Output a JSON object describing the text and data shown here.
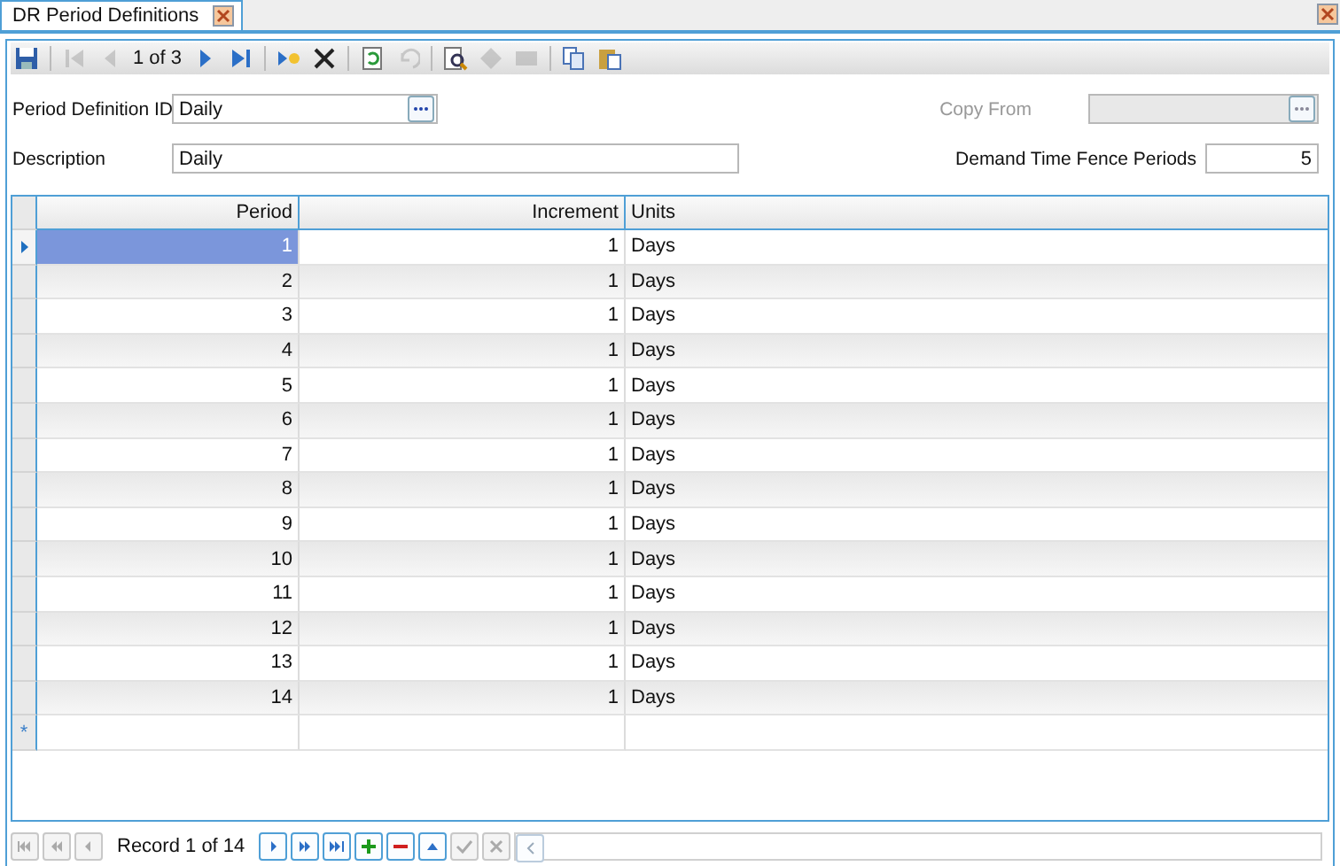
{
  "tab": {
    "title": "DR Period Definitions"
  },
  "toolbar": {
    "items": [
      {
        "kind": "save",
        "disabled": false
      },
      {
        "kind": "sep"
      },
      {
        "kind": "first",
        "disabled": true
      },
      {
        "kind": "prev",
        "disabled": true
      },
      {
        "kind": "position",
        "text": "1 of 3"
      },
      {
        "kind": "next",
        "disabled": false
      },
      {
        "kind": "last",
        "disabled": false
      },
      {
        "kind": "sep"
      },
      {
        "kind": "new",
        "disabled": false
      },
      {
        "kind": "delete",
        "disabled": false
      },
      {
        "kind": "sep"
      },
      {
        "kind": "refresh",
        "disabled": false
      },
      {
        "kind": "undo",
        "disabled": true
      },
      {
        "kind": "sep"
      },
      {
        "kind": "preview",
        "disabled": false
      },
      {
        "kind": "attach",
        "disabled": true
      },
      {
        "kind": "mail",
        "disabled": true
      },
      {
        "kind": "sep"
      },
      {
        "kind": "copy",
        "disabled": false
      },
      {
        "kind": "paste",
        "disabled": false
      }
    ]
  },
  "form": {
    "period_definition_id": {
      "label": "Period Definition ID",
      "value": "Daily"
    },
    "copy_from": {
      "label": "Copy From",
      "disabled": true
    },
    "description": {
      "label": "Description",
      "value": "Daily"
    },
    "demand_time_fence_periods": {
      "label": "Demand Time Fence Periods",
      "value": "5"
    }
  },
  "grid": {
    "columns": [
      "Period",
      "Increment",
      "Units"
    ],
    "rows": [
      {
        "period": "1",
        "increment": "1",
        "units": "Days",
        "selected": true
      },
      {
        "period": "2",
        "increment": "1",
        "units": "Days",
        "selected": false
      },
      {
        "period": "3",
        "increment": "1",
        "units": "Days",
        "selected": false
      },
      {
        "period": "4",
        "increment": "1",
        "units": "Days",
        "selected": false
      },
      {
        "period": "5",
        "increment": "1",
        "units": "Days",
        "selected": false
      },
      {
        "period": "6",
        "increment": "1",
        "units": "Days",
        "selected": false
      },
      {
        "period": "7",
        "increment": "1",
        "units": "Days",
        "selected": false
      },
      {
        "period": "8",
        "increment": "1",
        "units": "Days",
        "selected": false
      },
      {
        "period": "9",
        "increment": "1",
        "units": "Days",
        "selected": false
      },
      {
        "period": "10",
        "increment": "1",
        "units": "Days",
        "selected": false
      },
      {
        "period": "11",
        "increment": "1",
        "units": "Days",
        "selected": false
      },
      {
        "period": "12",
        "increment": "1",
        "units": "Days",
        "selected": false
      },
      {
        "period": "13",
        "increment": "1",
        "units": "Days",
        "selected": false
      },
      {
        "period": "14",
        "increment": "1",
        "units": "Days",
        "selected": false
      }
    ],
    "new_row_marker": "*"
  },
  "navigator": {
    "record_text": "Record 1 of 14",
    "buttons": [
      {
        "kind": "first",
        "disabled": true
      },
      {
        "kind": "prev-page",
        "disabled": true
      },
      {
        "kind": "prev",
        "disabled": true
      },
      {
        "kind": "record"
      },
      {
        "kind": "next",
        "disabled": false
      },
      {
        "kind": "next-page",
        "disabled": false
      },
      {
        "kind": "last",
        "disabled": false
      },
      {
        "kind": "add",
        "disabled": false
      },
      {
        "kind": "remove",
        "disabled": false
      },
      {
        "kind": "up",
        "disabled": false
      },
      {
        "kind": "check",
        "disabled": true
      },
      {
        "kind": "cancel",
        "disabled": true
      }
    ]
  }
}
